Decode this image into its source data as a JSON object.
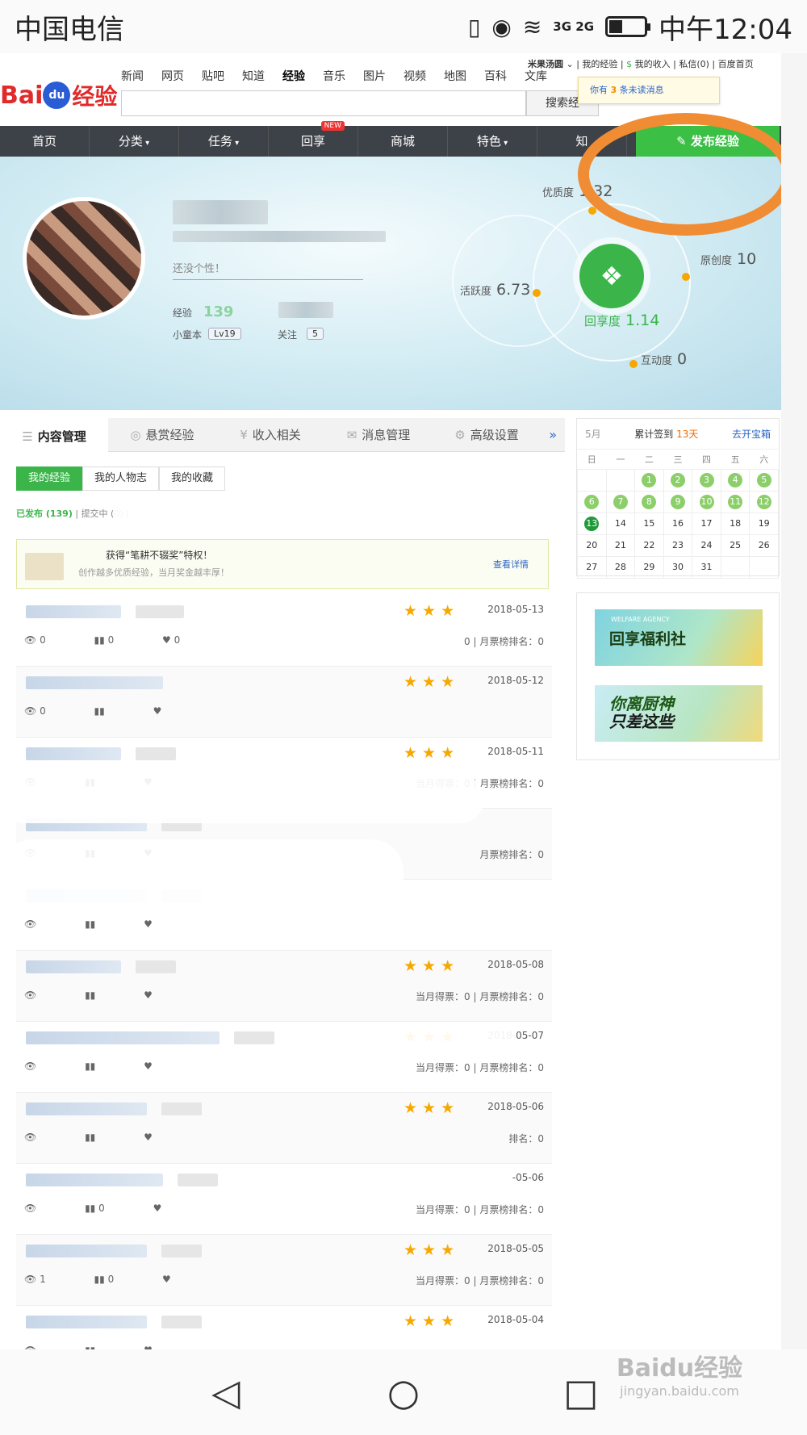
{
  "status_bar": {
    "carrier": "中国电信",
    "network": "3G 2G",
    "time": "中午12:04"
  },
  "header": {
    "logo_bai": "Bai",
    "logo_du": "du",
    "logo_jingyan": "经验",
    "top_nav": [
      "新闻",
      "网页",
      "贴吧",
      "知道",
      "经验",
      "音乐",
      "图片",
      "视频",
      "地图",
      "百科",
      "文库"
    ],
    "active_nav": "经验",
    "search_button": "搜索经",
    "user_links": {
      "user": "米果汤圆",
      "my_exp": "我的经验",
      "income": "我的收入",
      "msg": "私信(0)",
      "home": "百度首页"
    },
    "notice": {
      "prefix": "你有",
      "count": "3",
      "suffix": "条未读消息"
    }
  },
  "main_nav": {
    "items": [
      "首页",
      "分类",
      "任务",
      "回享",
      "商城",
      "特色",
      "知"
    ],
    "new_badge": "NEW",
    "publish": "发布经验"
  },
  "profile": {
    "signature": "还没个性！",
    "exp_label": "经验",
    "exp_value": "139",
    "level_label": "小童本",
    "level": "Lv19",
    "follow_label": "关注",
    "follow": "5"
  },
  "metrics": {
    "quality": {
      "label": "优质度",
      "value": "1.32"
    },
    "originality": {
      "label": "原创度",
      "value": "10"
    },
    "activity": {
      "label": "活跃度",
      "value": "6.73"
    },
    "share": {
      "label": "回享度",
      "value": "1.14"
    },
    "interaction": {
      "label": "互动度",
      "value": "0"
    }
  },
  "tabs": {
    "items": [
      {
        "label": "内容管理",
        "icon": "list-icon"
      },
      {
        "label": "悬赏经验",
        "icon": "coin-icon"
      },
      {
        "label": "收入相关",
        "icon": "yen-icon"
      },
      {
        "label": "消息管理",
        "icon": "mail-icon"
      },
      {
        "label": "高级设置",
        "icon": "gear-icon"
      }
    ],
    "more": "»"
  },
  "subtabs": [
    "我的经验",
    "我的人物志",
    "我的收藏"
  ],
  "filter": {
    "published": "已发布 (139)",
    "submitting": "提交中 (0)"
  },
  "promo": {
    "line1": "获得“笔耕不辍奖”特权！",
    "line2": "创作越多优质经验，当月奖金越丰厚！",
    "more": "查看详情"
  },
  "list": [
    {
      "date": "2018-05-13",
      "stars": "★★★",
      "stats": [
        "0",
        "0",
        "0"
      ],
      "rank": "0 | 月票榜排名：0"
    },
    {
      "date": "2018-05-12",
      "stars": "★★★",
      "stats": [
        "0",
        "",
        ""
      ],
      "rank": ""
    },
    {
      "date": "2018-05-11",
      "stars": "★★★",
      "stats": [
        "",
        "",
        ""
      ],
      "rank": "当月得票：0 | 月票榜排名：0"
    },
    {
      "date": "",
      "stars": "",
      "stats": [
        "",
        "",
        ""
      ],
      "rank": "月票榜排名：0"
    },
    {
      "date": "",
      "stars": "",
      "stats": [
        "",
        "",
        ""
      ],
      "rank": ""
    },
    {
      "date": "2018-05-08",
      "stars": "★★★",
      "stats": [
        "",
        "",
        ""
      ],
      "rank": "当月得票：0 | 月票榜排名：0"
    },
    {
      "date": "2018-05-07",
      "stars": "★★★",
      "stats": [
        "",
        "",
        ""
      ],
      "rank": "当月得票：0 | 月票榜排名：0"
    },
    {
      "date": "2018-05-06",
      "stars": "★★★",
      "stats": [
        "",
        "",
        ""
      ],
      "rank": "排名：0"
    },
    {
      "date": "-05-06",
      "stars": "",
      "stats": [
        "",
        "0",
        ""
      ],
      "rank": "当月得票：0 | 月票榜排名：0"
    },
    {
      "date": "2018-05-05",
      "stars": "★★★",
      "stats": [
        "1",
        "0",
        ""
      ],
      "rank": "当月得票：0 | 月票榜排名：0"
    },
    {
      "date": "2018-05-04",
      "stars": "★★★",
      "stats": [
        "",
        "",
        ""
      ],
      "rank": ""
    }
  ],
  "calendar": {
    "month": "5月",
    "signin_prefix": "累计签到",
    "signin_days": "13天",
    "open_box": "去开宝箱",
    "weekdays": [
      "日",
      "一",
      "二",
      "三",
      "四",
      "五",
      "六"
    ],
    "weeks": [
      [
        "",
        "",
        "1",
        "2",
        "3",
        "4",
        "5"
      ],
      [
        "6",
        "7",
        "8",
        "9",
        "10",
        "11",
        "12"
      ],
      [
        "13",
        "14",
        "15",
        "16",
        "17",
        "18",
        "19"
      ],
      [
        "20",
        "21",
        "22",
        "23",
        "24",
        "25",
        "26"
      ],
      [
        "27",
        "28",
        "29",
        "30",
        "31",
        "",
        ""
      ]
    ],
    "checked_until": 13,
    "today": "13"
  },
  "ads": {
    "ad1": "回享福利社",
    "ad1_small": "WELFARE AGENCY",
    "ad2_line1": "你离厨神",
    "ad2_line2": "只差这些"
  },
  "nav_bar": {
    "back": "◁",
    "home": "○",
    "recent": "□"
  },
  "watermark": {
    "brand": "Baidu经验",
    "url": "jingyan.baidu.com"
  }
}
